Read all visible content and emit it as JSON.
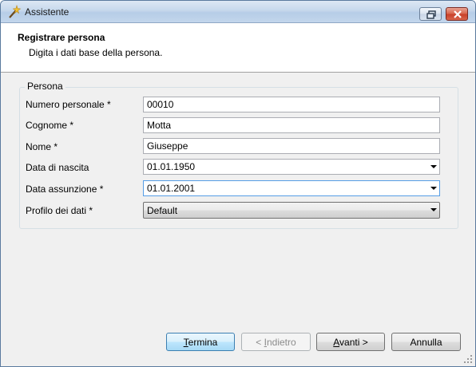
{
  "window": {
    "title": "Assistente"
  },
  "header": {
    "title": "Registrare persona",
    "subtitle": "Digita i dati base della persona."
  },
  "group": {
    "legend": "Persona"
  },
  "fields": {
    "numero_personale": {
      "label": "Numero personale *",
      "value": "00010"
    },
    "cognome": {
      "label": "Cognome *",
      "value": "Motta"
    },
    "nome": {
      "label": "Nome *",
      "value": "Giuseppe"
    },
    "data_nascita": {
      "label": "Data di nascita",
      "value": "01.01.1950"
    },
    "data_assunzione": {
      "label": "Data assunzione *",
      "value": "01.01.2001"
    },
    "profilo_dati": {
      "label": "Profilo dei dati *",
      "value": "Default"
    }
  },
  "buttons": {
    "termina": {
      "mnemonic": "T",
      "rest": "ermina"
    },
    "indietro": {
      "pre": "< ",
      "mnemonic": "I",
      "rest": "ndietro"
    },
    "avanti": {
      "mnemonic": "A",
      "rest": "vanti >"
    },
    "annulla": {
      "label": "Annulla"
    }
  },
  "colors": {
    "accent": "#3c7fb1",
    "focus_border": "#569de5",
    "close_red": "#c9402a"
  },
  "icons": {
    "app": "wizard-wand-icon",
    "restore": "restore-window-icon",
    "close": "close-icon",
    "dropdown": "chevron-down-icon",
    "resize": "resize-grip-icon"
  }
}
